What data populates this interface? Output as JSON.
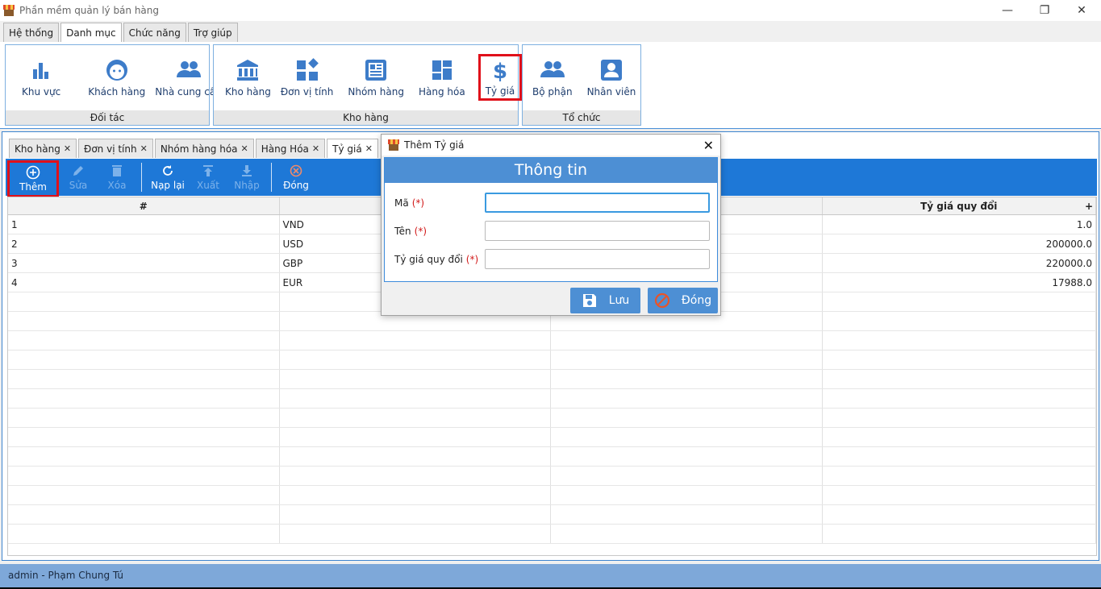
{
  "window": {
    "title": "Phần mềm quản lý bán hàng"
  },
  "menu": {
    "tabs": [
      "Hệ thống",
      "Danh mục",
      "Chức năng",
      "Trợ giúp"
    ]
  },
  "ribbon": {
    "groups": [
      {
        "title": "Đối tác",
        "items": [
          "Khu vực",
          "Khách hàng",
          "Nhà cung cấp"
        ]
      },
      {
        "title": "Kho hàng",
        "items": [
          "Kho hàng",
          "Đơn vị tính",
          "Nhóm hàng",
          "Hàng hóa",
          "Tỷ giá"
        ]
      },
      {
        "title": "Tổ chức",
        "items": [
          "Bộ phận",
          "Nhân viên"
        ]
      }
    ]
  },
  "doc_tabs": [
    "Kho hàng",
    "Đơn vị tính",
    "Nhóm hàng hóa",
    "Hàng Hóa",
    "Tỷ giá"
  ],
  "toolbar": {
    "them": "Thêm",
    "sua": "Sửa",
    "xoa": "Xóa",
    "naplai": "Nạp lại",
    "xuat": "Xuất",
    "nhap": "Nhập",
    "dong": "Đóng"
  },
  "table": {
    "headers": [
      "#",
      "",
      "",
      "Tỷ giá quy đổi"
    ],
    "rows": [
      [
        "1",
        "VND",
        "",
        "1.0"
      ],
      [
        "2",
        "USD",
        "",
        "200000.0"
      ],
      [
        "3",
        "GBP",
        "",
        "220000.0"
      ],
      [
        "4",
        "EUR",
        "",
        "17988.0"
      ]
    ]
  },
  "dialog": {
    "title": "Thêm Tỷ giá",
    "header": "Thông tin",
    "fields": [
      {
        "label": "Mã",
        "required": "(*)",
        "value": ""
      },
      {
        "label": "Tên",
        "required": "(*)",
        "value": ""
      },
      {
        "label": "Tỷ giá quy đổi",
        "required": "(*)",
        "value": ""
      }
    ],
    "save_label": "Lưu",
    "close_label": "Đóng"
  },
  "status": {
    "user": "admin - Phạm Chung Tú"
  },
  "colors": {
    "accent": "#1e78d7",
    "highlight": "#e0101a",
    "ribbon_icon": "#3d7cc9"
  }
}
